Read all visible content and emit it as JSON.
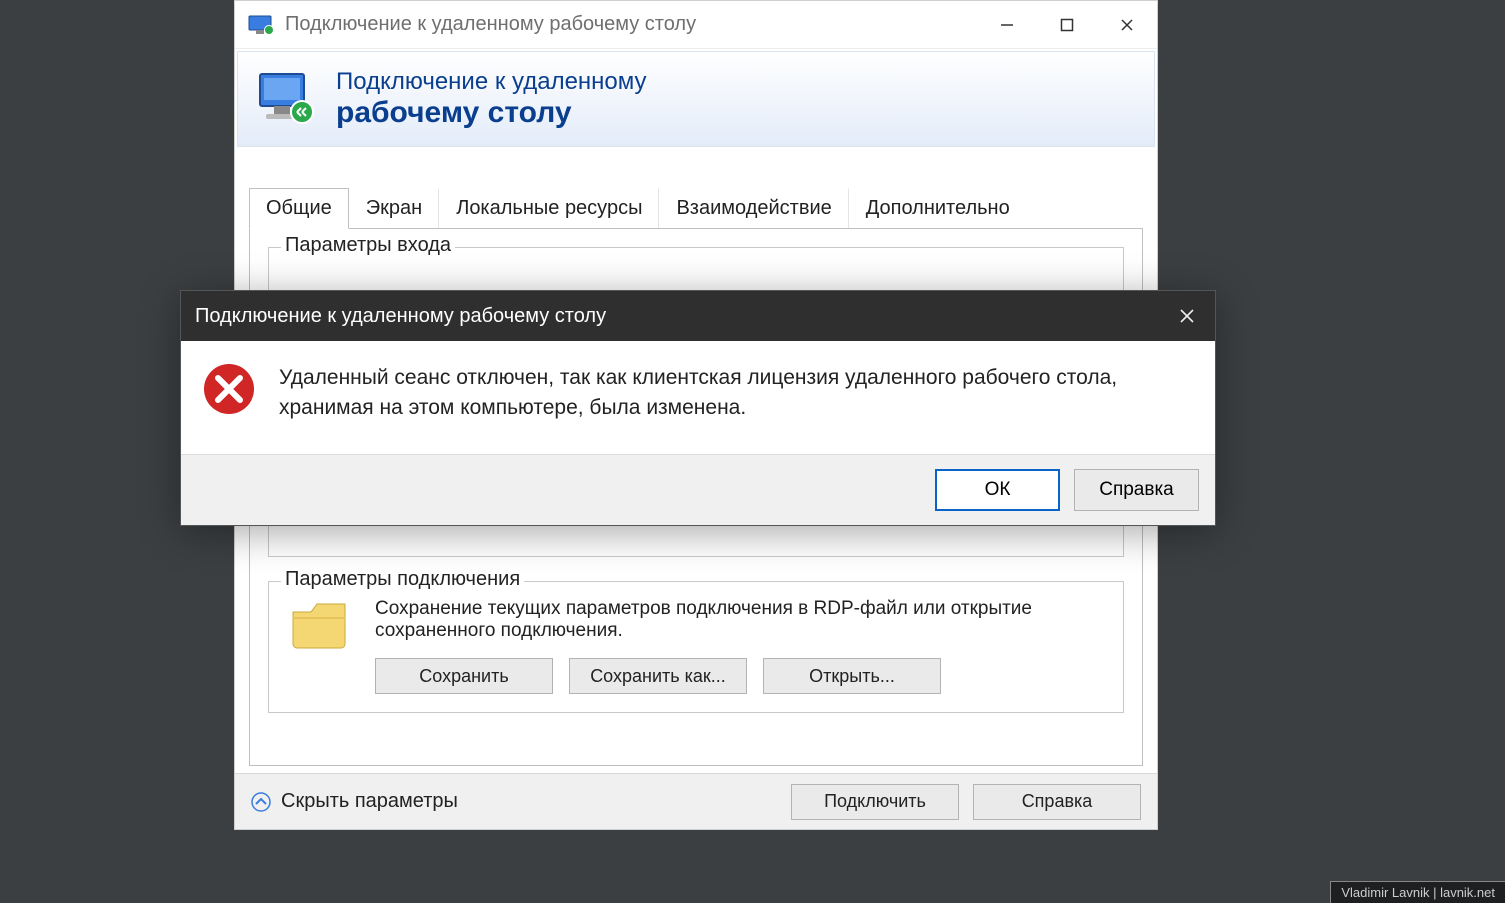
{
  "main": {
    "titlebar_text": "Подключение к удаленному рабочему столу",
    "banner_line1": "Подключение к удаленному",
    "banner_line2": "рабочему столу",
    "tabs": {
      "general": "Общие",
      "screen": "Экран",
      "local_resources": "Локальные ресурсы",
      "experience": "Взаимодействие",
      "advanced": "Дополнительно"
    },
    "login_group_legend": "Параметры входа",
    "conn_group": {
      "legend": "Параметры подключения",
      "description": "Сохранение текущих параметров подключения в RDP-файл или открытие сохраненного подключения.",
      "save": "Сохранить",
      "save_as": "Сохранить как...",
      "open": "Открыть..."
    },
    "footer": {
      "hide_params": "Скрыть параметры",
      "connect": "Подключить",
      "help": "Справка"
    }
  },
  "dialog": {
    "title": "Подключение к удаленному рабочему столу",
    "message": "Удаленный сеанс отключен, так как клиентская лицензия удаленного рабочего стола, хранимая на этом компьютере, была изменена.",
    "ok": "ОК",
    "help": "Справка"
  },
  "watermark": "Vladimir Lavnik | lavnik.net"
}
